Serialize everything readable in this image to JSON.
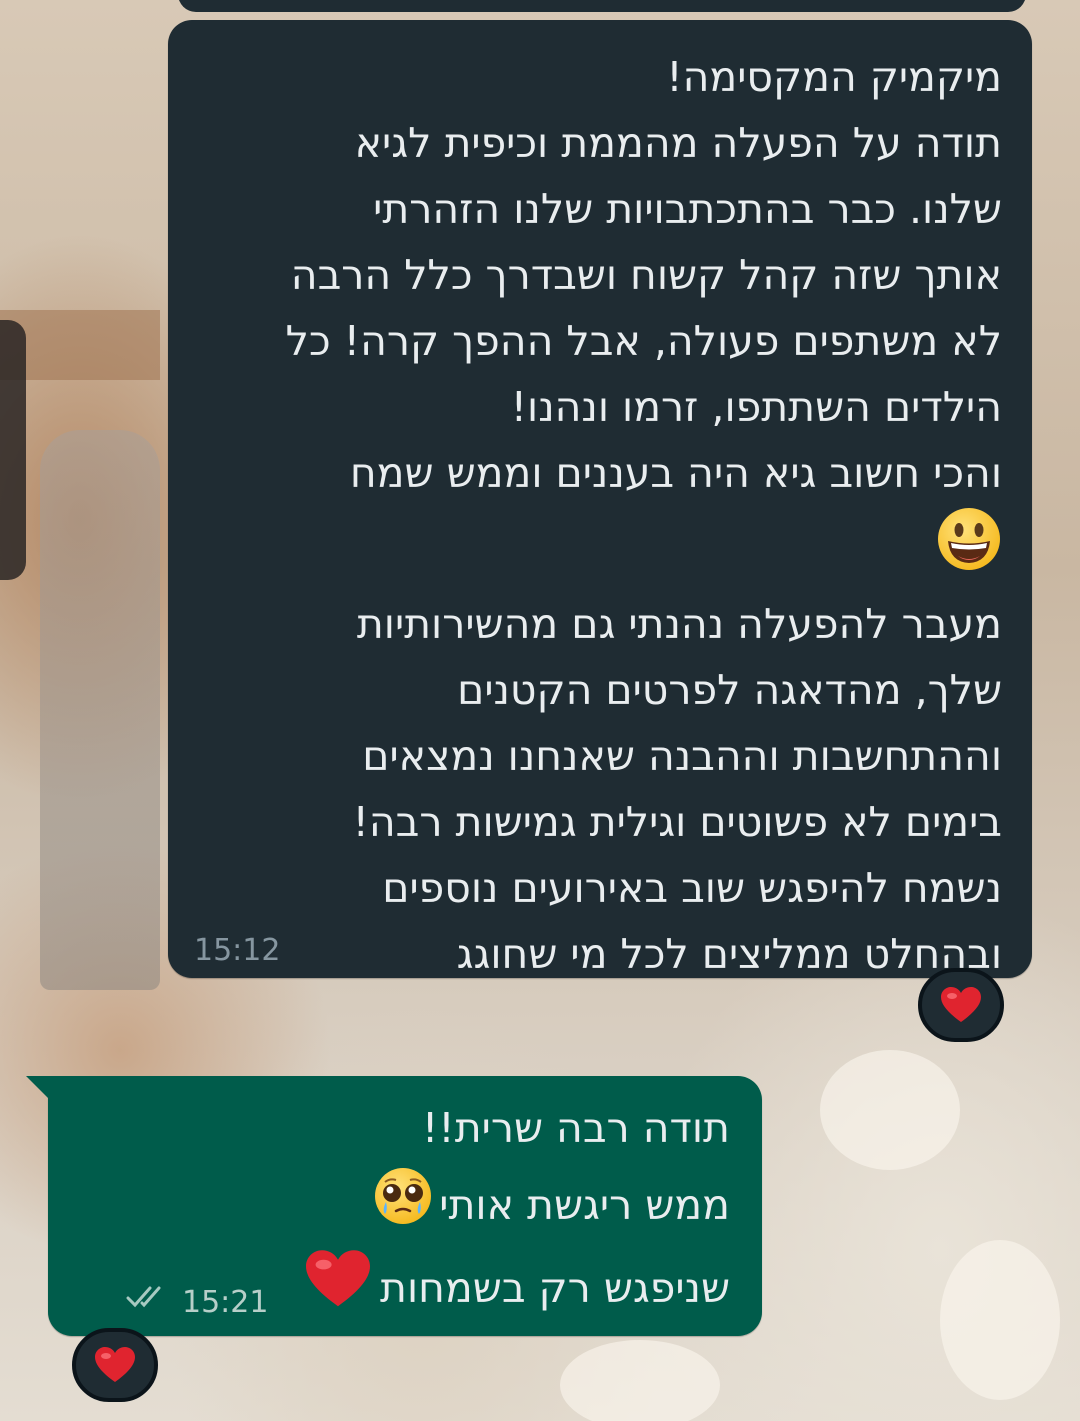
{
  "colors": {
    "incoming_bubble": "#1f2c33",
    "outgoing_bubble": "#005c4b",
    "text": "#e9edef",
    "timestamp": "#8696a0",
    "heart": "#e0242f"
  },
  "messages": {
    "incoming": {
      "lines": [
        "מיקמיק המקסימה!",
        "תודה על הפעלה מהממת וכיפית לגיא",
        "שלנו. כבר בהתכתבויות שלנו הזהרתי",
        "אותך שזה קהל קשוח ושבדרך כלל הרבה",
        "לא משתפים פעולה, אבל ההפך קרה! כל",
        "הילדים השתתפו, זרמו ונהנו!",
        "והכי חשוב גיא היה בעננים וממש שמח",
        "מעבר להפעלה נהנתי גם מהשירותיות",
        "שלך, מהדאגה לפרטים הקטנים",
        "וההתחשבות וההבנה שאנחנו נמצאים",
        "בימים לא פשוטים וגילית גמישות רבה!",
        "נשמח להיפגש שוב באירועים נוספים",
        "ובהחלט ממליצים לכל מי שחוגג"
      ],
      "emoji": "grinning-face-icon",
      "time": "15:12",
      "reaction": "red-heart-icon"
    },
    "outgoing": {
      "lines": [
        "תודה רבה שרית!!",
        "ממש ריגשת אותי",
        "שניפגש רק בשמחות"
      ],
      "emojis": [
        "pleading-face-icon",
        "red-heart-icon"
      ],
      "time": "15:21",
      "status": "read-double-check-icon",
      "reaction": "red-heart-icon"
    }
  }
}
